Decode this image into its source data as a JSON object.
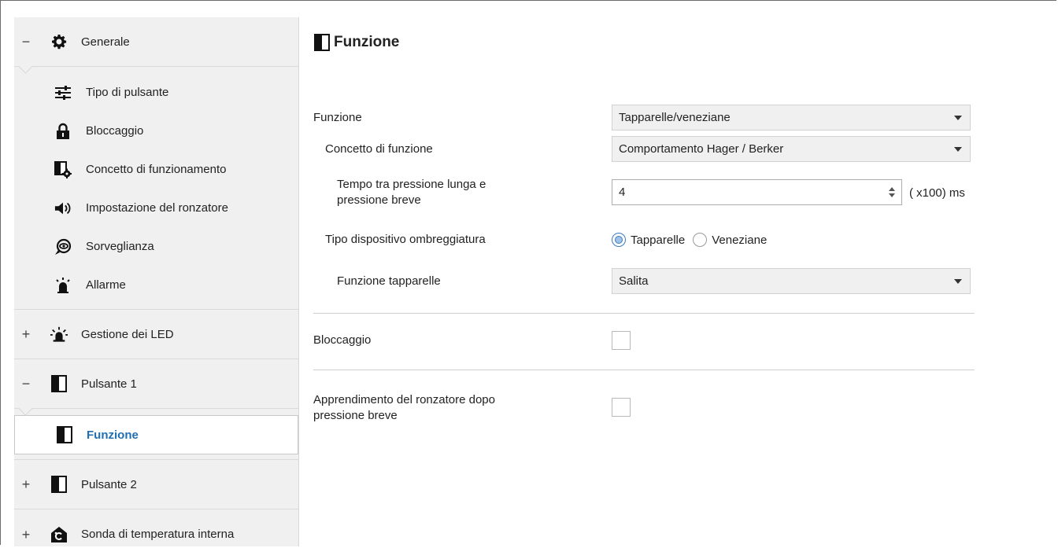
{
  "sidebar": {
    "groups": [
      {
        "toggle": "−",
        "label": "Generale",
        "icon": "gear-icon"
      },
      {
        "toggle": "+",
        "label": "Gestione dei LED",
        "icon": "led-icon"
      },
      {
        "toggle": "−",
        "label": "Pulsante 1",
        "icon": "button-panel-icon"
      },
      {
        "toggle": "+",
        "label": "Pulsante 2",
        "icon": "button-panel-icon"
      },
      {
        "toggle": "+",
        "label": "Sonda di temperatura interna",
        "icon": "thermometer-house-icon"
      }
    ],
    "generale_items": [
      {
        "label": "Tipo di pulsante",
        "icon": "sliders-icon"
      },
      {
        "label": "Bloccaggio",
        "icon": "lock-icon"
      },
      {
        "label": "Concetto di funzionamento",
        "icon": "settings-panel-icon"
      },
      {
        "label": "Impostazione del ronzatore",
        "icon": "speaker-icon"
      },
      {
        "label": "Sorveglianza",
        "icon": "eye-icon"
      },
      {
        "label": "Allarme",
        "icon": "alarm-icon"
      }
    ],
    "pulsante1_items": [
      {
        "label": "Funzione",
        "icon": "button-panel-icon"
      }
    ]
  },
  "main": {
    "title": "Funzione",
    "title_icon": "button-panel-icon",
    "funzione": {
      "label": "Funzione",
      "value": "Tapparelle/veneziane"
    },
    "concetto": {
      "label": "Concetto di funzione",
      "value": "Comportamento Hager / Berker"
    },
    "tempo": {
      "label_line1": "Tempo tra pressione lunga e",
      "label_line2": "pressione breve",
      "value": "4",
      "unit": "( x100) ms"
    },
    "tipo_dispositivo": {
      "label": "Tipo dispositivo ombreggiatura",
      "options": [
        "Tapparelle",
        "Veneziane"
      ],
      "selected": "Tapparelle"
    },
    "funzione_tapparelle": {
      "label": "Funzione tapparelle",
      "value": "Salita"
    },
    "bloccaggio": {
      "label": "Bloccaggio",
      "checked": false
    },
    "apprendimento": {
      "label_line1": "Apprendimento del ronzatore dopo",
      "label_line2": "pressione breve",
      "checked": false
    }
  },
  "colors": {
    "accent": "#1f6fb2",
    "sidebar_bg": "#f0f0f0",
    "select_bg": "#f0f0f0"
  }
}
